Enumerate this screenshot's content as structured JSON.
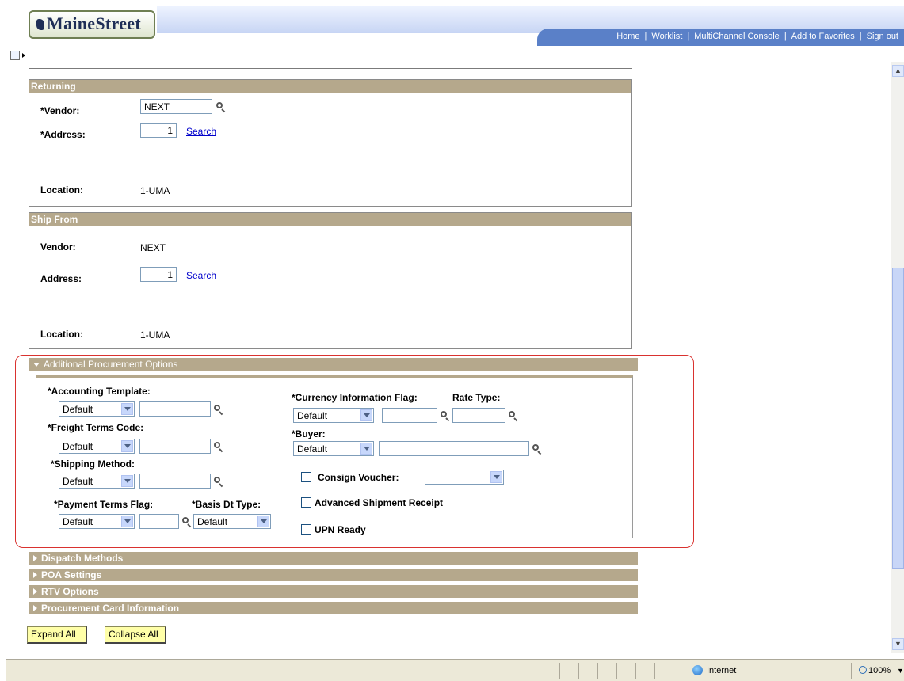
{
  "header": {
    "logo_text": "MaineStreet",
    "nav": [
      "Home",
      "Worklist",
      "MultiChannel Console",
      "Add to Favorites",
      "Sign out"
    ]
  },
  "returning": {
    "title": "Returning",
    "vendor_label": "*Vendor:",
    "vendor_value": "NEXT",
    "address_label": "*Address:",
    "address_value": "1",
    "search_link": "Search",
    "location_label": "Location:",
    "location_value": "1-UMA"
  },
  "ship_from": {
    "title": "Ship From",
    "vendor_label": "Vendor:",
    "vendor_value": "NEXT",
    "address_label": "Address:",
    "address_value": "1",
    "search_link": "Search",
    "location_label": "Location:",
    "location_value": "1-UMA"
  },
  "apo": {
    "title": "Additional Procurement Options",
    "accounting_template_label": "*Accounting Template:",
    "accounting_template_value": "Default",
    "freight_terms_label": "*Freight Terms Code:",
    "freight_terms_value": "Default",
    "shipping_method_label": "*Shipping Method:",
    "shipping_method_value": "Default",
    "payment_terms_label": "*Payment Terms Flag:",
    "payment_terms_value": "Default",
    "basis_dt_label": "*Basis Dt Type:",
    "basis_dt_value": "Default",
    "currency_flag_label": "*Currency Information Flag:",
    "currency_flag_value": "Default",
    "rate_type_label": "Rate Type:",
    "buyer_label": "*Buyer:",
    "buyer_value": "Default",
    "consign_voucher_label": "Consign Voucher:",
    "asr_label": "Advanced Shipment Receipt",
    "upn_label": "UPN Ready"
  },
  "collapsed_sections": [
    "Dispatch Methods",
    "POA Settings",
    "RTV Options",
    "Procurement Card Information"
  ],
  "buttons": {
    "expand_all": "Expand All",
    "collapse_all": "Collapse All"
  },
  "status_bar": {
    "zone": "Internet",
    "zoom": "100%"
  },
  "colors": {
    "section_header": "#b5a88c",
    "nav_band": "#5a80c8",
    "highlight": "#d9322f",
    "button": "#ffffa8"
  }
}
